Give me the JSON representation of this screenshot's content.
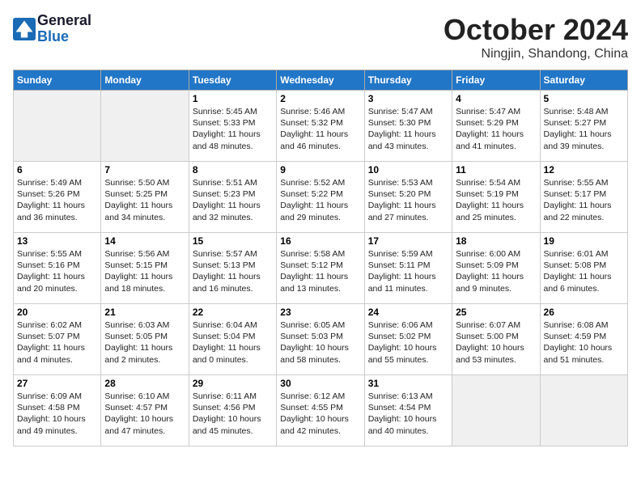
{
  "header": {
    "logo_line1": "General",
    "logo_line2": "Blue",
    "month": "October 2024",
    "location": "Ningjin, Shandong, China"
  },
  "days_of_week": [
    "Sunday",
    "Monday",
    "Tuesday",
    "Wednesday",
    "Thursday",
    "Friday",
    "Saturday"
  ],
  "weeks": [
    [
      {
        "day": "",
        "empty": true
      },
      {
        "day": "",
        "empty": true
      },
      {
        "day": "1",
        "sunrise": "5:45 AM",
        "sunset": "5:33 PM",
        "daylight": "11 hours and 48 minutes."
      },
      {
        "day": "2",
        "sunrise": "5:46 AM",
        "sunset": "5:32 PM",
        "daylight": "11 hours and 46 minutes."
      },
      {
        "day": "3",
        "sunrise": "5:47 AM",
        "sunset": "5:30 PM",
        "daylight": "11 hours and 43 minutes."
      },
      {
        "day": "4",
        "sunrise": "5:47 AM",
        "sunset": "5:29 PM",
        "daylight": "11 hours and 41 minutes."
      },
      {
        "day": "5",
        "sunrise": "5:48 AM",
        "sunset": "5:27 PM",
        "daylight": "11 hours and 39 minutes."
      }
    ],
    [
      {
        "day": "6",
        "sunrise": "5:49 AM",
        "sunset": "5:26 PM",
        "daylight": "11 hours and 36 minutes."
      },
      {
        "day": "7",
        "sunrise": "5:50 AM",
        "sunset": "5:25 PM",
        "daylight": "11 hours and 34 minutes."
      },
      {
        "day": "8",
        "sunrise": "5:51 AM",
        "sunset": "5:23 PM",
        "daylight": "11 hours and 32 minutes."
      },
      {
        "day": "9",
        "sunrise": "5:52 AM",
        "sunset": "5:22 PM",
        "daylight": "11 hours and 29 minutes."
      },
      {
        "day": "10",
        "sunrise": "5:53 AM",
        "sunset": "5:20 PM",
        "daylight": "11 hours and 27 minutes."
      },
      {
        "day": "11",
        "sunrise": "5:54 AM",
        "sunset": "5:19 PM",
        "daylight": "11 hours and 25 minutes."
      },
      {
        "day": "12",
        "sunrise": "5:55 AM",
        "sunset": "5:17 PM",
        "daylight": "11 hours and 22 minutes."
      }
    ],
    [
      {
        "day": "13",
        "sunrise": "5:55 AM",
        "sunset": "5:16 PM",
        "daylight": "11 hours and 20 minutes."
      },
      {
        "day": "14",
        "sunrise": "5:56 AM",
        "sunset": "5:15 PM",
        "daylight": "11 hours and 18 minutes."
      },
      {
        "day": "15",
        "sunrise": "5:57 AM",
        "sunset": "5:13 PM",
        "daylight": "11 hours and 16 minutes."
      },
      {
        "day": "16",
        "sunrise": "5:58 AM",
        "sunset": "5:12 PM",
        "daylight": "11 hours and 13 minutes."
      },
      {
        "day": "17",
        "sunrise": "5:59 AM",
        "sunset": "5:11 PM",
        "daylight": "11 hours and 11 minutes."
      },
      {
        "day": "18",
        "sunrise": "6:00 AM",
        "sunset": "5:09 PM",
        "daylight": "11 hours and 9 minutes."
      },
      {
        "day": "19",
        "sunrise": "6:01 AM",
        "sunset": "5:08 PM",
        "daylight": "11 hours and 6 minutes."
      }
    ],
    [
      {
        "day": "20",
        "sunrise": "6:02 AM",
        "sunset": "5:07 PM",
        "daylight": "11 hours and 4 minutes."
      },
      {
        "day": "21",
        "sunrise": "6:03 AM",
        "sunset": "5:05 PM",
        "daylight": "11 hours and 2 minutes."
      },
      {
        "day": "22",
        "sunrise": "6:04 AM",
        "sunset": "5:04 PM",
        "daylight": "11 hours and 0 minutes."
      },
      {
        "day": "23",
        "sunrise": "6:05 AM",
        "sunset": "5:03 PM",
        "daylight": "10 hours and 58 minutes."
      },
      {
        "day": "24",
        "sunrise": "6:06 AM",
        "sunset": "5:02 PM",
        "daylight": "10 hours and 55 minutes."
      },
      {
        "day": "25",
        "sunrise": "6:07 AM",
        "sunset": "5:00 PM",
        "daylight": "10 hours and 53 minutes."
      },
      {
        "day": "26",
        "sunrise": "6:08 AM",
        "sunset": "4:59 PM",
        "daylight": "10 hours and 51 minutes."
      }
    ],
    [
      {
        "day": "27",
        "sunrise": "6:09 AM",
        "sunset": "4:58 PM",
        "daylight": "10 hours and 49 minutes."
      },
      {
        "day": "28",
        "sunrise": "6:10 AM",
        "sunset": "4:57 PM",
        "daylight": "10 hours and 47 minutes."
      },
      {
        "day": "29",
        "sunrise": "6:11 AM",
        "sunset": "4:56 PM",
        "daylight": "10 hours and 45 minutes."
      },
      {
        "day": "30",
        "sunrise": "6:12 AM",
        "sunset": "4:55 PM",
        "daylight": "10 hours and 42 minutes."
      },
      {
        "day": "31",
        "sunrise": "6:13 AM",
        "sunset": "4:54 PM",
        "daylight": "10 hours and 40 minutes."
      },
      {
        "day": "",
        "empty": true
      },
      {
        "day": "",
        "empty": true
      }
    ]
  ]
}
